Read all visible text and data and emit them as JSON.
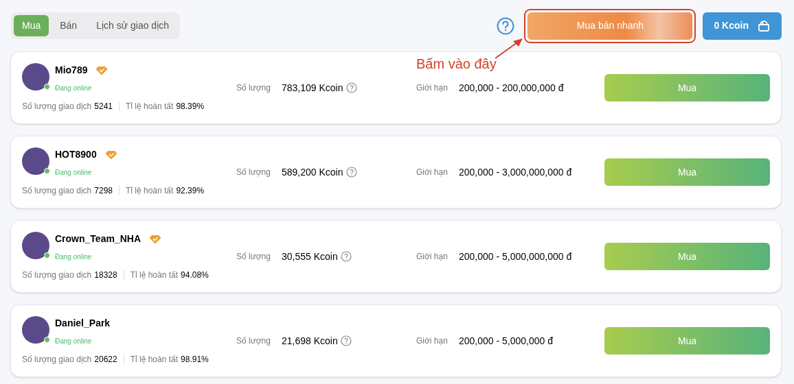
{
  "tabs": [
    {
      "label": "Mua",
      "selected": true
    },
    {
      "label": "Bán",
      "selected": false
    },
    {
      "label": "Lịch sử giao dịch",
      "selected": false
    }
  ],
  "quick_trade_button": {
    "label": "Mua bán nhanh",
    "highlighted": true
  },
  "balance_button": {
    "label": "0 Kcoin"
  },
  "annotation": {
    "text": "Bấm vào đây"
  },
  "offers": [
    {
      "name": "Mio789",
      "verified": true,
      "online": true,
      "status": "Đang online",
      "trades_label": "Số lượng giao dịch",
      "trades": "5241",
      "rate_label": "Tỉ lệ hoàn tất",
      "rate": "98.39%",
      "amount_label": "Số lượng",
      "amount": "783,109 Kcoin",
      "limit_label": "Giới hạn",
      "limit": "200,000 - 200,000,000 đ",
      "button": "Mua"
    },
    {
      "name": "HOT8900",
      "verified": true,
      "online": true,
      "status": "Đang online",
      "trades_label": "Số lượng giao dịch",
      "trades": "7298",
      "rate_label": "Tỉ lệ hoàn tất",
      "rate": "92.39%",
      "amount_label": "Số lượng",
      "amount": "589,200 Kcoin",
      "limit_label": "Giới hạn",
      "limit": "200,000 - 3,000,000,000 đ",
      "button": "Mua"
    },
    {
      "name": "Crown_Team_NHA",
      "verified": true,
      "online": true,
      "status": "Đang online",
      "trades_label": "Số lượng giao dịch",
      "trades": "18328",
      "rate_label": "Tỉ lệ hoàn tất",
      "rate": "94.08%",
      "amount_label": "Số lượng",
      "amount": "30,555 Kcoin",
      "limit_label": "Giới hạn",
      "limit": "200,000 - 5,000,000,000 đ",
      "button": "Mua"
    },
    {
      "name": "Daniel_Park",
      "verified": false,
      "online": true,
      "status": "Đang online",
      "trades_label": "Số lượng giao dịch",
      "trades": "20622",
      "rate_label": "Tỉ lệ hoàn tất",
      "rate": "98.91%",
      "amount_label": "Số lượng",
      "amount": "21,698 Kcoin",
      "limit_label": "Giới hạn",
      "limit": "200,000 - 5,000,000 đ",
      "button": "Mua"
    }
  ]
}
